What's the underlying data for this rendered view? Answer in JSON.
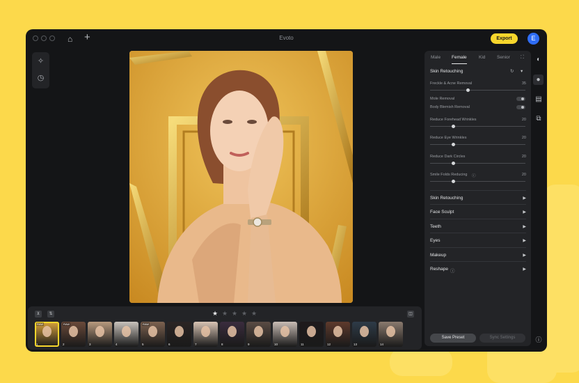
{
  "app": {
    "title": "Evoto",
    "export_label": "Export",
    "avatar_letter": "E"
  },
  "panel": {
    "tabs": [
      "Male",
      "Female",
      "Kid",
      "Senior"
    ],
    "active_tab": "Female",
    "section_title": "Skin Retouching",
    "sliders": [
      {
        "label": "Freckle & Acne Removal",
        "value": "35",
        "level": 0.35
      },
      {
        "label": "Reduce Forehead Wrinkles",
        "value": "20",
        "level": 0.2
      },
      {
        "label": "Reduce Eye Wrinkles",
        "value": "20",
        "level": 0.2
      },
      {
        "label": "Reduce Dark Circles",
        "value": "20",
        "level": 0.2
      },
      {
        "label": "Smile Folds Reducing",
        "value": "20",
        "level": 0.2
      }
    ],
    "toggles": [
      {
        "label": "Mole Removal",
        "on": false
      },
      {
        "label": "Body Blemish Removal",
        "on": false
      }
    ],
    "collapsed_sections": [
      "Skin Retouching",
      "Face Sculpt",
      "Teeth",
      "Eyes",
      "Makeup",
      "Reshape"
    ],
    "save_preset": "Save Preset",
    "sync_settings": "Sync Settings"
  },
  "filmstrip": {
    "rating_stars": 5,
    "rating_value": 1,
    "thumbnails": [
      {
        "n": "1",
        "raw": "RAW",
        "color": "#d9a23c"
      },
      {
        "n": "2",
        "raw": "RAW",
        "color": "#6a4a3a"
      },
      {
        "n": "3",
        "raw": "",
        "color": "#b89a7e"
      },
      {
        "n": "4",
        "raw": "",
        "color": "#c8c2bc"
      },
      {
        "n": "5",
        "raw": "RAW",
        "color": "#7d6250"
      },
      {
        "n": "6",
        "raw": "",
        "color": "#2b2524"
      },
      {
        "n": "7",
        "raw": "",
        "color": "#d8c4b4"
      },
      {
        "n": "8",
        "raw": "",
        "color": "#3a2c3e"
      },
      {
        "n": "9",
        "raw": "",
        "color": "#5a4c44"
      },
      {
        "n": "10",
        "raw": "",
        "color": "#c9bdb5"
      },
      {
        "n": "11",
        "raw": "",
        "color": "#1e1a1c"
      },
      {
        "n": "12",
        "raw": "",
        "color": "#5e3a2c"
      },
      {
        "n": "13",
        "raw": "",
        "color": "#2e3b48"
      },
      {
        "n": "14",
        "raw": "",
        "color": "#8a7a6e"
      }
    ]
  },
  "colors": {
    "accent": "#f7d62c",
    "background": "#fcd94b",
    "app_bg": "#141517",
    "panel_bg": "#232427"
  }
}
